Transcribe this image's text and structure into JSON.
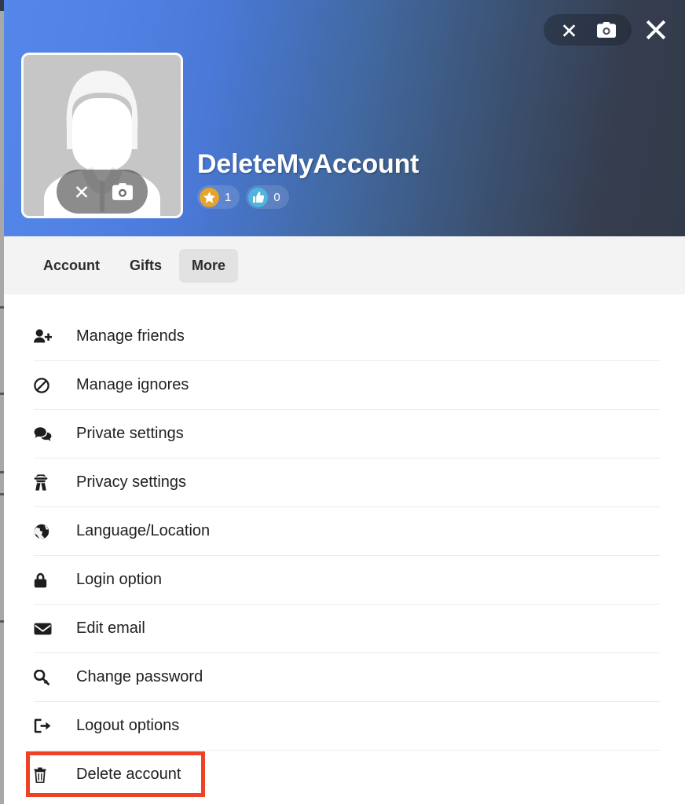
{
  "window": {
    "theme_accent_left": "#5586e9",
    "theme_accent_right": "#353d4e",
    "highlight_color": "#ef4123"
  },
  "header": {
    "controls": [
      {
        "name": "remove-cover-photo",
        "icon": "close-x-icon",
        "label": "✕"
      },
      {
        "name": "change-cover-photo",
        "icon": "camera-icon",
        "label": ""
      }
    ],
    "close_button": {
      "name": "close-dialog",
      "icon": "close-icon",
      "label": "✕"
    },
    "avatar": {
      "icon": "user-silhouette-avatar",
      "controls": [
        {
          "name": "remove-avatar",
          "icon": "close-x-icon"
        },
        {
          "name": "change-avatar",
          "icon": "camera-icon"
        }
      ]
    },
    "username": "DeleteMyAccount",
    "badges": [
      {
        "icon": "star-icon",
        "count": "1",
        "color": "#e5a42a"
      },
      {
        "icon": "thumbs-up-icon",
        "count": "0",
        "color": "#4fb5df"
      }
    ]
  },
  "tabs": [
    {
      "label": "Account",
      "active": false
    },
    {
      "label": "Gifts",
      "active": false
    },
    {
      "label": "More",
      "active": true
    }
  ],
  "menu": {
    "items": [
      {
        "label": "Manage friends",
        "icon": "user-plus-icon"
      },
      {
        "label": "Manage ignores",
        "icon": "ban-icon"
      },
      {
        "label": "Private settings",
        "icon": "comments-icon"
      },
      {
        "label": "Privacy settings",
        "icon": "user-secret-icon"
      },
      {
        "label": "Language/Location",
        "icon": "globe-icon"
      },
      {
        "label": "Login option",
        "icon": "lock-icon"
      },
      {
        "label": "Edit email",
        "icon": "envelope-icon"
      },
      {
        "label": "Change password",
        "icon": "key-icon"
      },
      {
        "label": "Logout options",
        "icon": "sign-out-icon"
      },
      {
        "label": "Delete account",
        "icon": "trash-icon",
        "highlighted": true
      }
    ]
  }
}
